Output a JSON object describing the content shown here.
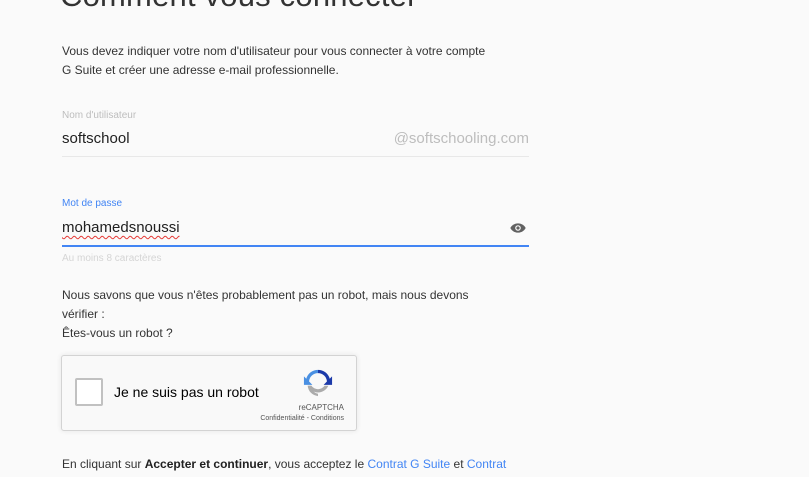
{
  "header": {
    "title": "Comment vous connecter"
  },
  "intro": {
    "line1": "Vous devez indiquer votre nom d'utilisateur pour vous connecter à votre compte",
    "line2": "G Suite et créer une adresse e-mail professionnelle."
  },
  "username": {
    "label": "Nom d'utilisateur",
    "value": "softschool",
    "domain_suffix": "@softschooling.com"
  },
  "password": {
    "label": "Mot de passe",
    "value": "mohamedsnoussi",
    "hint": "Au moins 8 caractères",
    "visibility_icon": "eye-icon"
  },
  "robot_check": {
    "line1": "Nous savons que vous n'êtes probablement pas un robot, mais nous devons",
    "line2": "vérifier :",
    "line3": "Êtes-vous un robot ?"
  },
  "captcha": {
    "label": "Je ne suis pas un robot",
    "brand": "reCAPTCHA",
    "privacy_link": "Confidentialité",
    "separator": " - ",
    "terms_link": "Conditions",
    "checked": false
  },
  "terms": {
    "prefix": "En cliquant sur ",
    "action": "Accepter et continuer",
    "middle": ", vous acceptez le ",
    "link1": "Contrat G Suite",
    "and": " et ",
    "link2": "Contrat"
  },
  "colors": {
    "accent": "#4285f4",
    "background": "#fafafa",
    "text": "#212121",
    "muted": "#bdbdbd"
  }
}
